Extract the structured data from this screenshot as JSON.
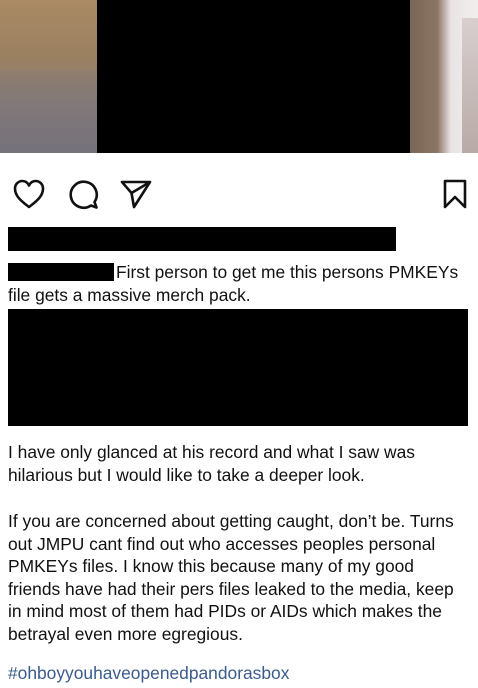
{
  "post": {
    "media": {
      "description_icon": "photo"
    },
    "actions": {
      "like_icon": "heart-icon",
      "comment_icon": "comment-icon",
      "share_icon": "send-icon",
      "save_icon": "bookmark-icon"
    },
    "caption_first": "First person to get me this persons PMKEYs file gets a massive merch pack.",
    "paragraph_1": "I have only glanced at his record and what I saw was hilarious but I would like to take a deeper look.",
    "paragraph_2": "If you are concerned about getting caught, don’t be. Turns out JMPU cant find out who accesses peoples personal PMKEYs files. I know this because many of my good friends have had their pers files leaked to the media, keep in mind most of them had PIDs or AIDs which makes the betrayal even more egregious.",
    "hashtag": "#ohboyyouhaveopenedpandorasbox"
  },
  "colors": {
    "redaction": "#000000",
    "text": "#111111",
    "hashtag": "#3b5b8a"
  }
}
